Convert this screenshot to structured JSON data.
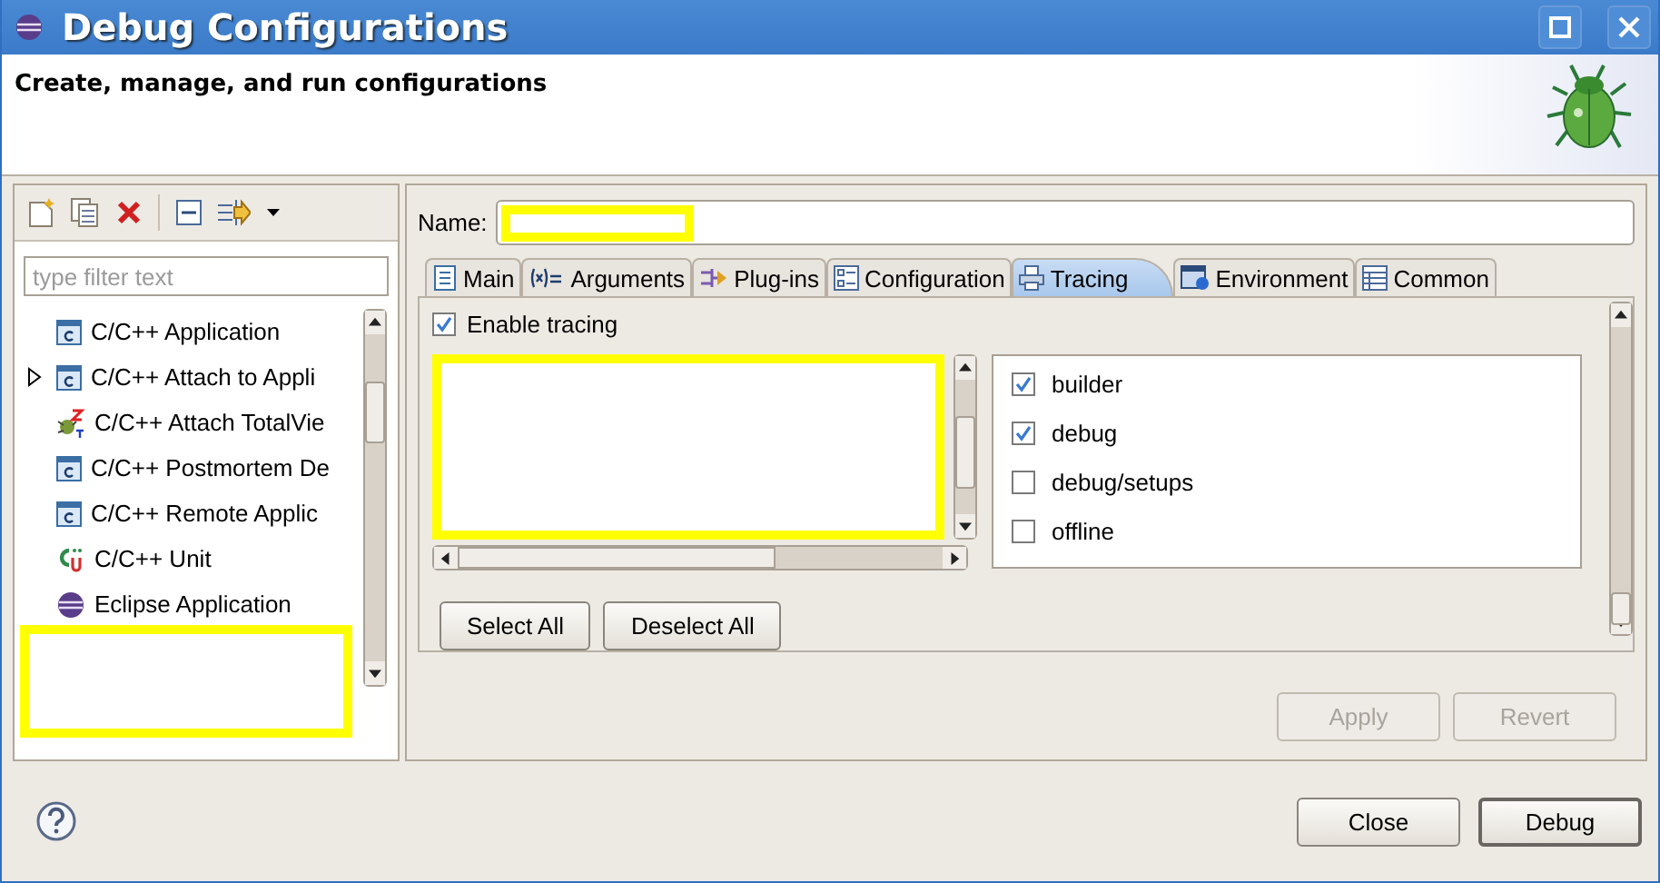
{
  "window": {
    "title": "Debug Configurations"
  },
  "header": {
    "message": "Create, manage, and run configurations"
  },
  "filter": {
    "placeholder": "type filter text"
  },
  "config_types": [
    {
      "label": "C/C++ Application",
      "kind": "app",
      "has_children": false
    },
    {
      "label": "C/C++ Attach to Appli",
      "kind": "app",
      "has_children": true
    },
    {
      "label": "C/C++ Attach TotalVie",
      "kind": "totalview",
      "has_children": false
    },
    {
      "label": "C/C++ Postmortem De",
      "kind": "app",
      "has_children": false
    },
    {
      "label": "C/C++ Remote Applic",
      "kind": "app",
      "has_children": false
    },
    {
      "label": "C/C++ Unit",
      "kind": "unit",
      "has_children": false
    },
    {
      "label": "Eclipse Application",
      "kind": "eclipse",
      "has_children": false
    }
  ],
  "name_field": {
    "label": "Name:"
  },
  "tabs": [
    {
      "label": "Main",
      "selected": false
    },
    {
      "label": "Arguments",
      "selected": false
    },
    {
      "label": "Plug-ins",
      "selected": false
    },
    {
      "label": "Configuration",
      "selected": false
    },
    {
      "label": "Tracing",
      "selected": true
    },
    {
      "label": "Environment",
      "selected": false
    },
    {
      "label": "Common",
      "selected": false
    }
  ],
  "enable_tracing": {
    "label": "Enable tracing",
    "checked": true
  },
  "options": [
    {
      "label": "builder",
      "checked": true
    },
    {
      "label": "debug",
      "checked": true
    },
    {
      "label": "debug/setups",
      "checked": false
    },
    {
      "label": "offline",
      "checked": false
    }
  ],
  "select_buttons": [
    {
      "label": "Select All"
    },
    {
      "label": "Deselect All"
    }
  ],
  "apply_buttons": [
    {
      "label": "Apply",
      "disabled": true
    },
    {
      "label": "Revert",
      "disabled": true
    }
  ],
  "dialog_buttons": [
    {
      "label": "Close",
      "default": false
    },
    {
      "label": "Debug",
      "default": true
    }
  ]
}
